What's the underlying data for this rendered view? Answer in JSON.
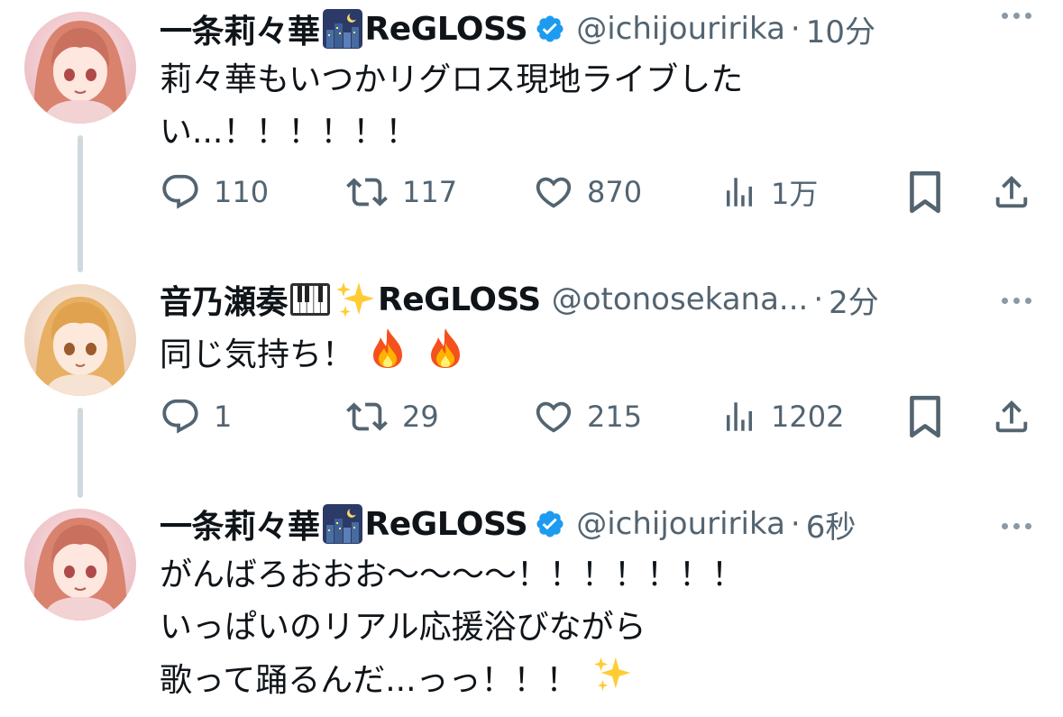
{
  "tweets": [
    {
      "name": "一条莉々華",
      "group": "ReGLOSS",
      "handle": "@ichijouririka",
      "separator": "·",
      "time": "10分",
      "text_lines": [
        "莉々華もいつかリグロス現地ライブした",
        "い...！！！！！！"
      ],
      "counts": {
        "reply": "110",
        "retweet": "117",
        "like": "870",
        "views": "1万"
      }
    },
    {
      "name": "音乃瀬奏",
      "group": "ReGLOSS",
      "handle": "@otonosekana...",
      "separator": "·",
      "time": "2分",
      "text_lines": [
        "同じ気持ち！"
      ],
      "counts": {
        "reply": "1",
        "retweet": "29",
        "like": "215",
        "views": "1202"
      }
    },
    {
      "name": "一条莉々華",
      "group": "ReGLOSS",
      "handle": "@ichijouririka",
      "separator": "·",
      "time": "6秒",
      "text_lines": [
        "がんばろおおお〜〜〜〜！！！！！！！",
        "いっぱいのリアル応援浴びながら",
        "歌って踊るんだ...っっ！！！"
      ]
    }
  ],
  "icons": {
    "reply": "reply-icon",
    "retweet": "retweet-icon",
    "like": "heart-icon",
    "views": "views-icon",
    "bookmark": "bookmark-icon",
    "share": "share-icon",
    "verified": "verified-badge-icon",
    "more": "more-icon"
  },
  "colors": {
    "text": "#0f1419",
    "secondary": "#536471",
    "verified": "#1d9bf0",
    "thread_line": "#cfd9de"
  }
}
